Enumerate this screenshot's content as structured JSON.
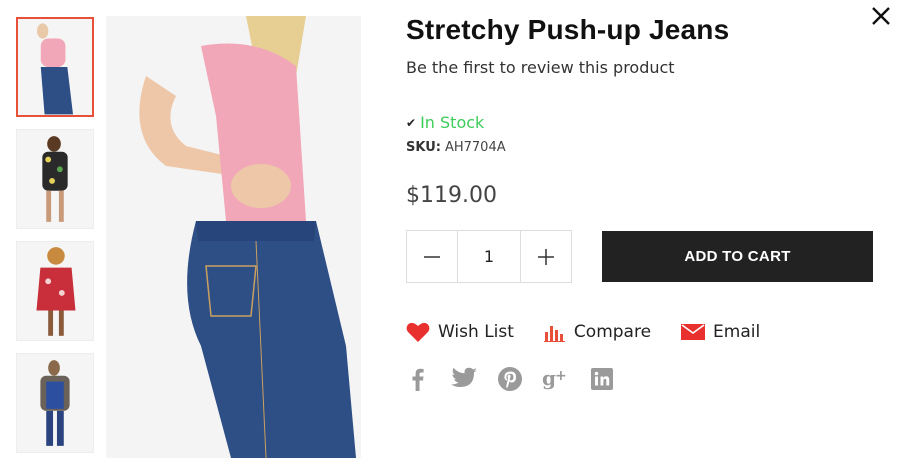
{
  "product": {
    "title": "Stretchy Push-up Jeans",
    "review_link": "Be the first to review this product",
    "stock_status": "In Stock",
    "sku_label": "SKU:",
    "sku_value": "AH7704A",
    "price": "$119.00"
  },
  "cart": {
    "quantity": "1",
    "add_to_cart_label": "ADD TO CART"
  },
  "actions": {
    "wishlist_label": "Wish List",
    "compare_label": "Compare",
    "email_label": "Email"
  },
  "icons": {
    "close": "close-icon",
    "check": "check-icon",
    "minus": "minus-icon",
    "plus": "plus-icon",
    "heart": "heart-icon",
    "compare": "bar-chart-icon",
    "email": "envelope-icon",
    "social": [
      "facebook-icon",
      "twitter-icon",
      "pinterest-icon",
      "google-plus-icon",
      "linkedin-icon"
    ]
  },
  "colors": {
    "accent": "#e8503a",
    "stock_green": "#3ecc5a",
    "button_dark": "#222222",
    "social_gray": "#9a9a9a"
  }
}
